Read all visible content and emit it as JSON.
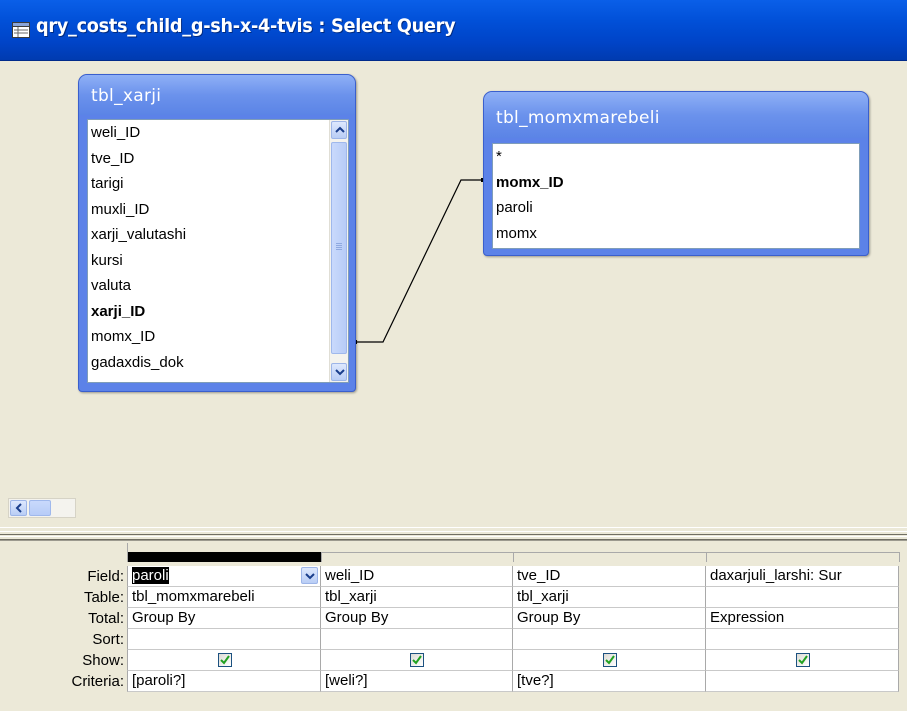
{
  "window": {
    "title": "qry_costs_child_g-sh-x-4-tvis : Select Query"
  },
  "tables": [
    {
      "name": "tbl_xarji",
      "fields": [
        "weli_ID",
        "tve_ID",
        "tarigi",
        "muxli_ID",
        "xarji_valutashi",
        "kursi",
        "valuta",
        "xarji_ID",
        "momx_ID",
        "gadaxdis_dok"
      ],
      "key_field": "xarji_ID"
    },
    {
      "name": "tbl_momxmarebeli",
      "fields": [
        "*",
        "momx_ID",
        "paroli",
        "momx"
      ],
      "key_field": "momx_ID"
    }
  ],
  "grid": {
    "row_labels": {
      "field": "Field:",
      "table": "Table:",
      "total": "Total:",
      "sort": "Sort:",
      "show": "Show:",
      "criteria": "Criteria:"
    },
    "columns": [
      {
        "field": "paroli",
        "table": "tbl_momxmarebeli",
        "total": "Group By",
        "sort": "",
        "show": true,
        "criteria": "[paroli?]"
      },
      {
        "field": "weli_ID",
        "table": "tbl_xarji",
        "total": "Group By",
        "sort": "",
        "show": true,
        "criteria": "[weli?]"
      },
      {
        "field": "tve_ID",
        "table": "tbl_xarji",
        "total": "Group By",
        "sort": "",
        "show": true,
        "criteria": "[tve?]"
      },
      {
        "field": "daxarjuli_larshi: Sur",
        "table": "",
        "total": "Expression",
        "sort": "",
        "show": true,
        "criteria": ""
      }
    ]
  },
  "colors": {
    "title_bar": "#0054e3",
    "table_caption": "#6b92ec",
    "workspace": "#ece9d8",
    "check": "#21a121"
  }
}
